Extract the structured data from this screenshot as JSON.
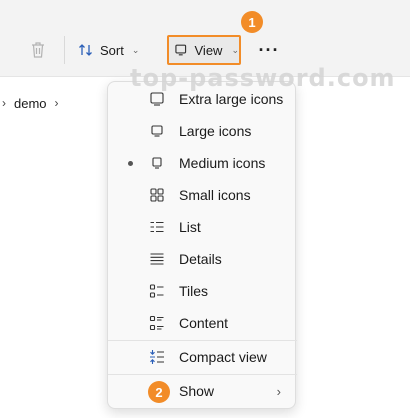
{
  "toolbar": {
    "delete_icon": "trash-icon",
    "sort_label": "Sort",
    "view_label": "View",
    "more_label": "···"
  },
  "breadcrumb": {
    "items": [
      "demo"
    ]
  },
  "watermark": "top-password.com",
  "annotations": {
    "step1": "1",
    "step2": "2"
  },
  "menu": {
    "items": [
      {
        "label": "Extra large icons",
        "icon": "extra-large-icons-icon"
      },
      {
        "label": "Large icons",
        "icon": "large-icons-icon"
      },
      {
        "label": "Medium icons",
        "icon": "medium-icons-icon",
        "selected": true
      },
      {
        "label": "Small icons",
        "icon": "small-icons-icon"
      },
      {
        "label": "List",
        "icon": "list-icon"
      },
      {
        "label": "Details",
        "icon": "details-icon"
      },
      {
        "label": "Tiles",
        "icon": "tiles-icon"
      },
      {
        "label": "Content",
        "icon": "content-icon"
      }
    ],
    "compact_label": "Compact view",
    "show_label": "Show",
    "show_arrow": "›"
  },
  "colors": {
    "accent": "#f28c28",
    "menu_bg": "#f9f9f9",
    "toolbar_bg": "#f3f3f3"
  }
}
